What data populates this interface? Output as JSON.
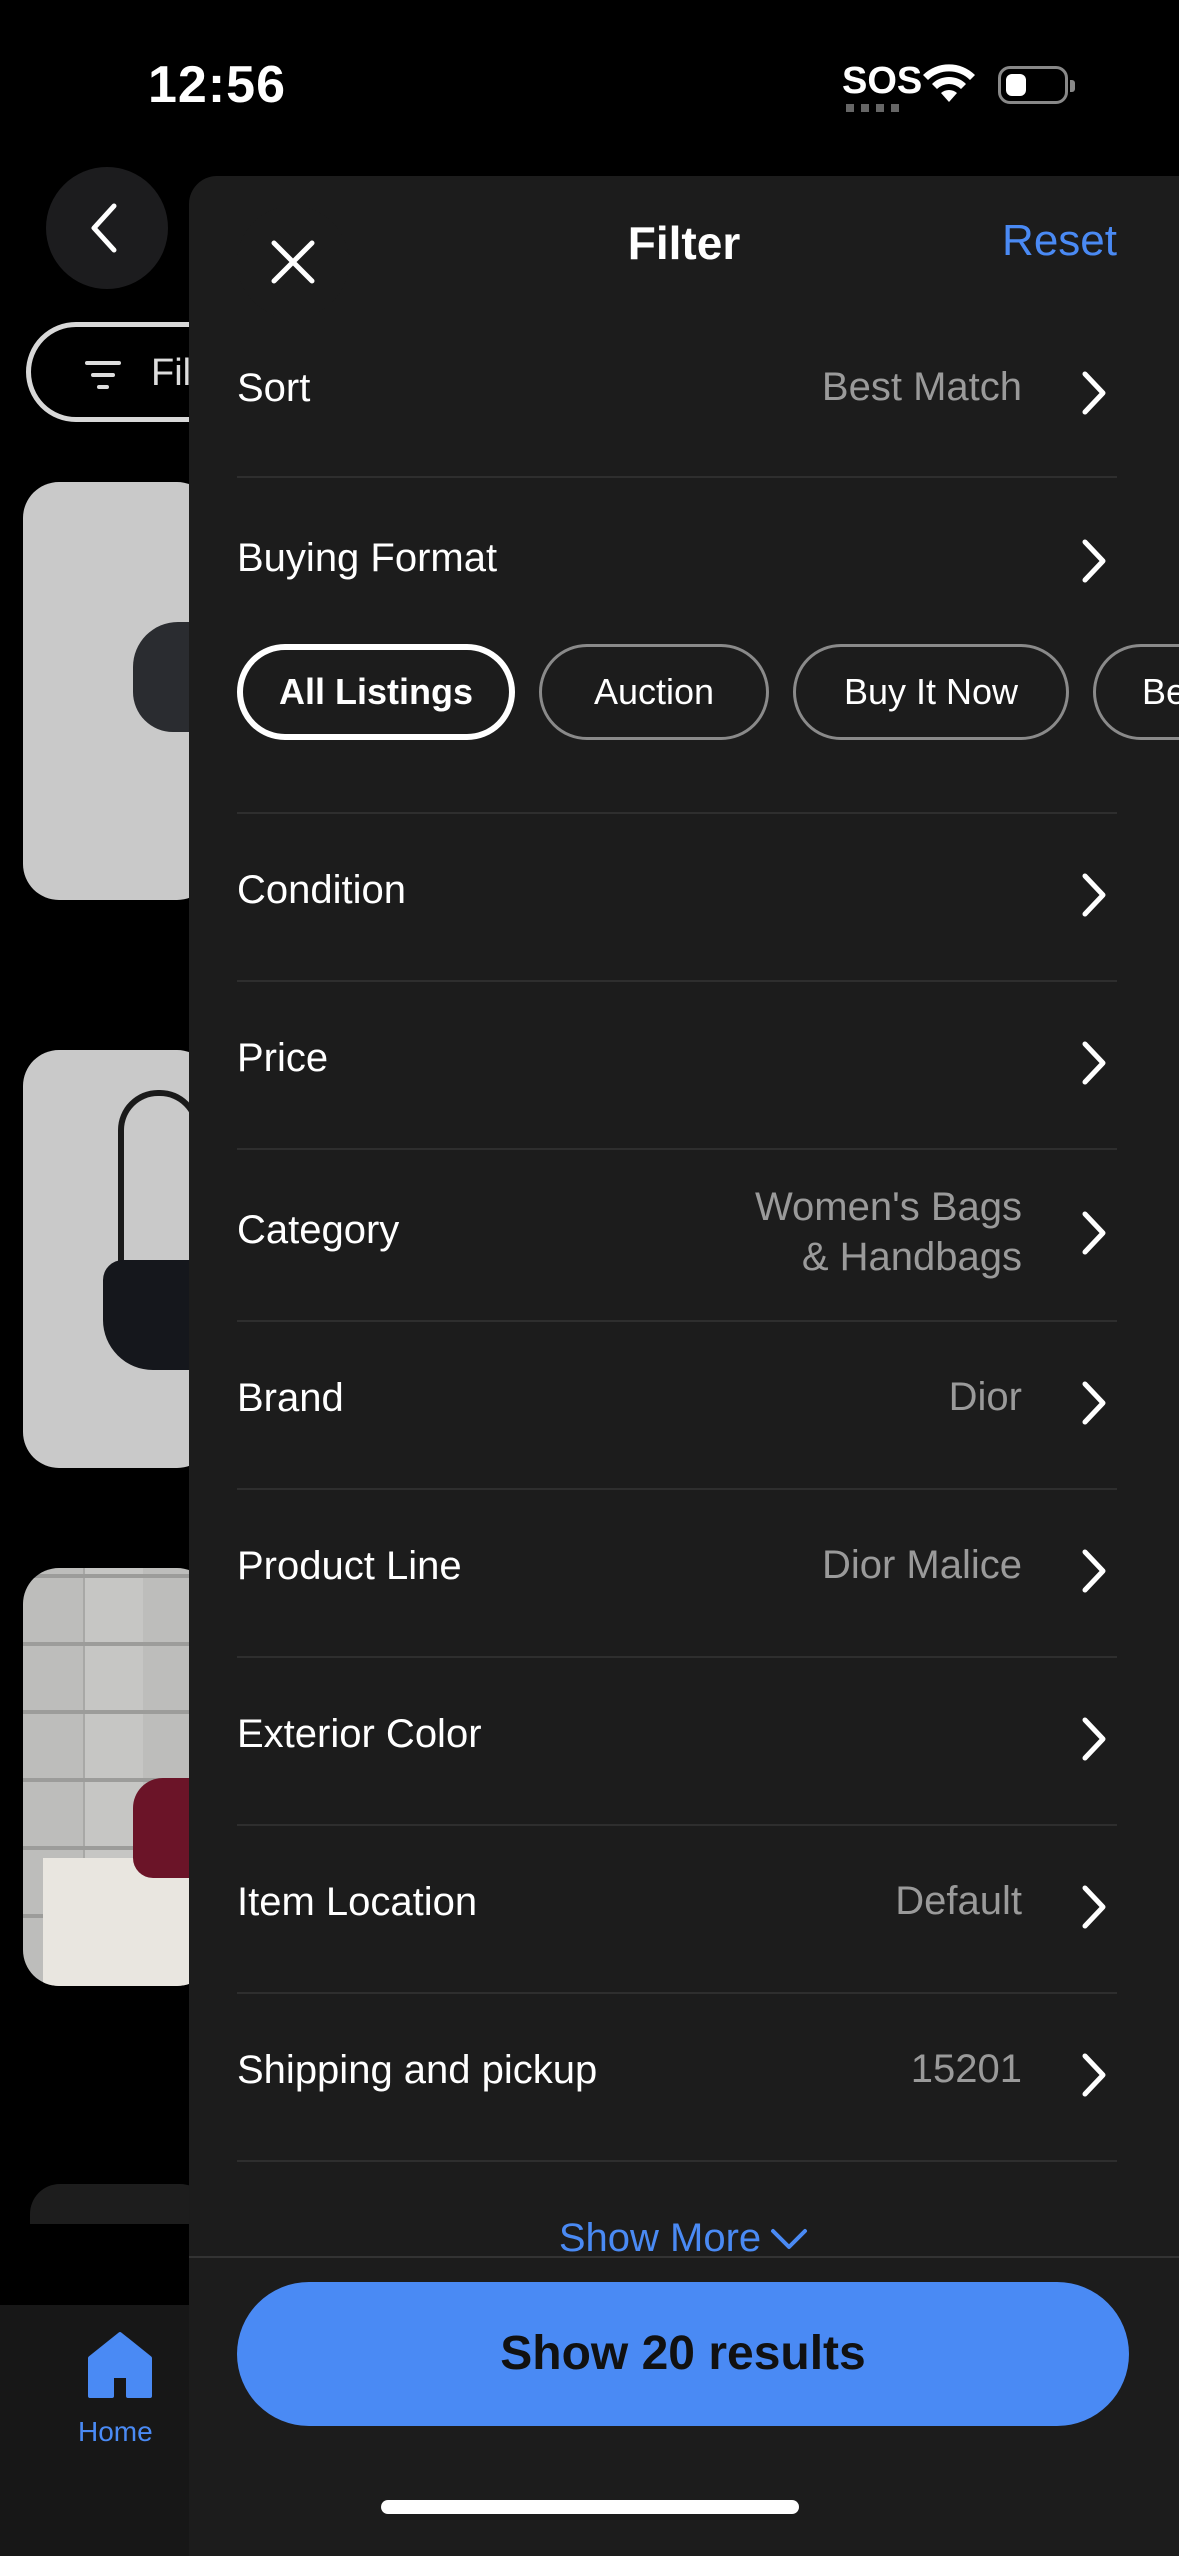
{
  "status_bar": {
    "time": "12:56",
    "sos": "SOS"
  },
  "background": {
    "filter_pill_label": "Fil",
    "tabbar": {
      "home_label": "Home"
    }
  },
  "filter": {
    "title": "Filter",
    "reset_label": "Reset",
    "rows": [
      {
        "label": "Sort",
        "value": "Best Match"
      },
      {
        "label": "Buying Format",
        "value": ""
      },
      {
        "label": "Condition",
        "value": ""
      },
      {
        "label": "Price",
        "value": ""
      },
      {
        "label": "Category",
        "value_line1": "Women's Bags",
        "value_line2": "& Handbags"
      },
      {
        "label": "Brand",
        "value": "Dior"
      },
      {
        "label": "Product Line",
        "value": "Dior Malice"
      },
      {
        "label": "Exterior Color",
        "value": ""
      },
      {
        "label": "Item Location",
        "value": "Default"
      },
      {
        "label": "Shipping and pickup",
        "value": "15201"
      }
    ],
    "buying_format_chips": [
      {
        "label": "All Listings",
        "selected": true
      },
      {
        "label": "Auction",
        "selected": false
      },
      {
        "label": "Buy It Now",
        "selected": false
      },
      {
        "label": "Be",
        "selected": false
      }
    ],
    "show_more_label": "Show More",
    "show_results_label": "Show 20 results"
  },
  "colors": {
    "accent": "#4a8af4",
    "sheet_bg": "#1c1c1c",
    "muted_text": "#9a9a9a"
  }
}
